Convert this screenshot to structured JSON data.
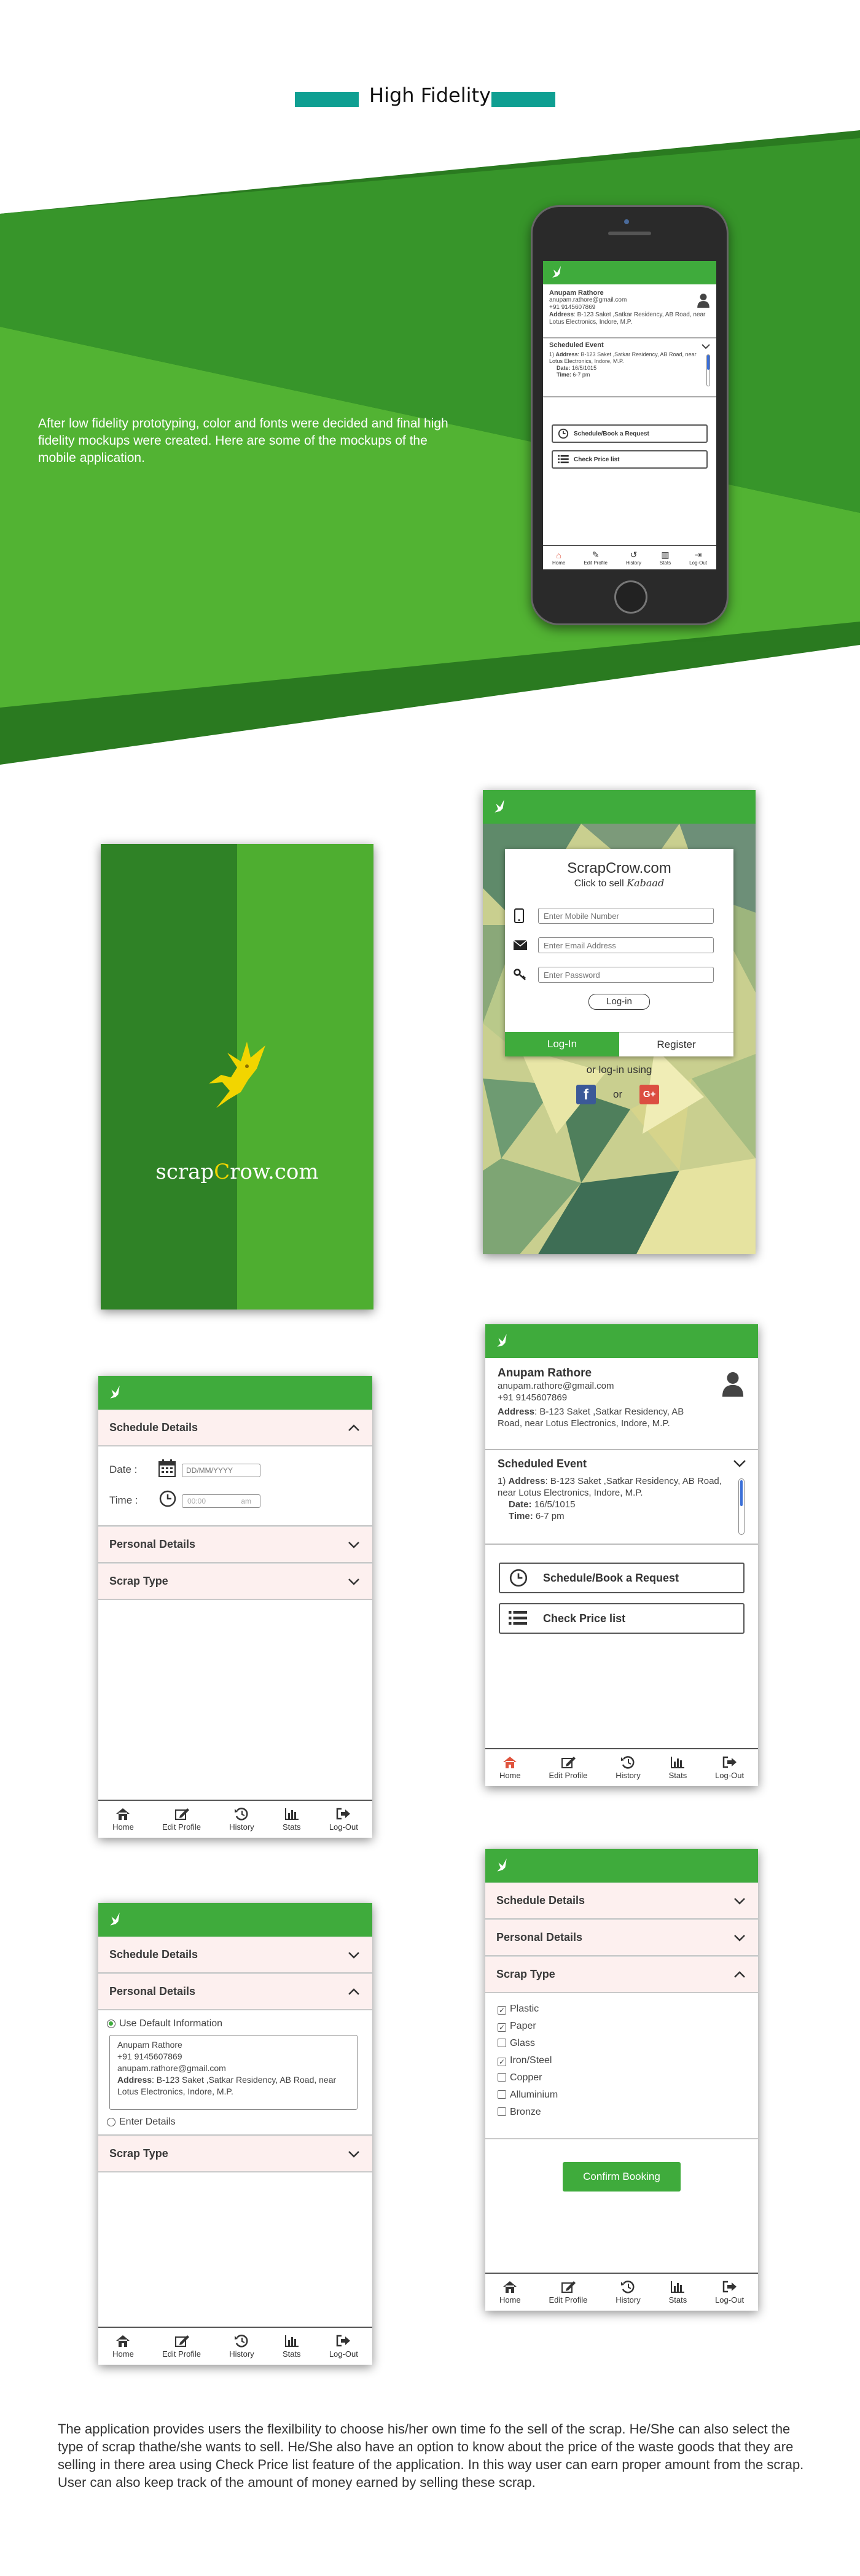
{
  "header": {
    "title": "High Fidelity"
  },
  "intro": {
    "text": "After low fidelity prototyping, color and fonts were decided and final high fidelity mockups were created. Here are some of the mockups of the mobile application."
  },
  "colors": {
    "brand_green": "#3fab3c",
    "dark_green": "#2e7f24",
    "teal": "#0f9f92",
    "accent_red": "#e0533d"
  },
  "splash": {
    "logo_text_left": "scrap",
    "logo_text_c": "C",
    "logo_text_right": "row.com"
  },
  "login": {
    "title": "ScrapCrow.com",
    "tagline": "Click to sell",
    "tagline_script": "Kabaad",
    "mobile_placeholder": "Enter Mobile Number",
    "email_placeholder": "Enter Email Address",
    "password_placeholder": "Enter Password",
    "login_button": "Log-in",
    "tab_login": "Log-In",
    "tab_register": "Register",
    "or_text": "or log-in using",
    "or_small": "or"
  },
  "profile": {
    "name": "Anupam Rathore",
    "email": "anupam.rathore@gmail.com",
    "phone": "+91 9145607869",
    "address_label": "Address",
    "address": ": B-123 Saket ,Satkar Residency, AB Road, near Lotus Electronics, Indore, M.P.",
    "scheduled_title": "Scheduled Event",
    "event_num": "1)",
    "event_address_label": "Address",
    "event_address": ": B-123 Saket ,Satkar Residency, AB Road, near Lotus Electronics, Indore, M.P.",
    "date_label": "Date:",
    "date_value": "16/5/1015",
    "time_label": "Time:",
    "time_value": "6-7 pm",
    "schedule_button": "Schedule/Book a Request",
    "price_button": "Check Price list"
  },
  "nav": [
    "Home",
    "Edit Profile",
    "History",
    "Stats",
    "Log-Out"
  ],
  "schedule": {
    "section_schedule": "Schedule Details",
    "section_personal": "Personal Details",
    "section_scrap": "Scrap Type",
    "date_label": "Date :",
    "date_placeholder": "DD/MM/YYYY",
    "time_label": "Time :",
    "time_placeholder": "00:00",
    "time_ampm": "am"
  },
  "personal": {
    "use_default": "Use Default Information",
    "name": "Anupam Rathore",
    "phone": "+91 9145607869",
    "email": "anupam.rathore@gmail.com",
    "address_label": "Address",
    "address": ": B-123 Saket ,Satkar Residency, AB Road, near Lotus Electronics, Indore, M.P.",
    "enter_details": "Enter Details"
  },
  "scrap": {
    "items": [
      {
        "label": "Plastic",
        "checked": true
      },
      {
        "label": "Paper",
        "checked": true
      },
      {
        "label": "Glass",
        "checked": false
      },
      {
        "label": "Iron/Steel",
        "checked": true
      },
      {
        "label": "Copper",
        "checked": false
      },
      {
        "label": "Alluminium",
        "checked": false
      },
      {
        "label": "Bronze",
        "checked": false
      }
    ],
    "confirm": "Confirm Booking"
  },
  "outro": {
    "text": "The application provides users the flexilbility to choose his/her own time fo the sell of the scrap. He/She can also select the type of scrap thathe/she wants to sell. He/She also have an option to know about the price of the waste goods that they are selling in there area using Check Price list feature of the application. In this way user can earn proper amount from the scrap. User can also keep track of the amount of money earned by selling these scrap."
  }
}
